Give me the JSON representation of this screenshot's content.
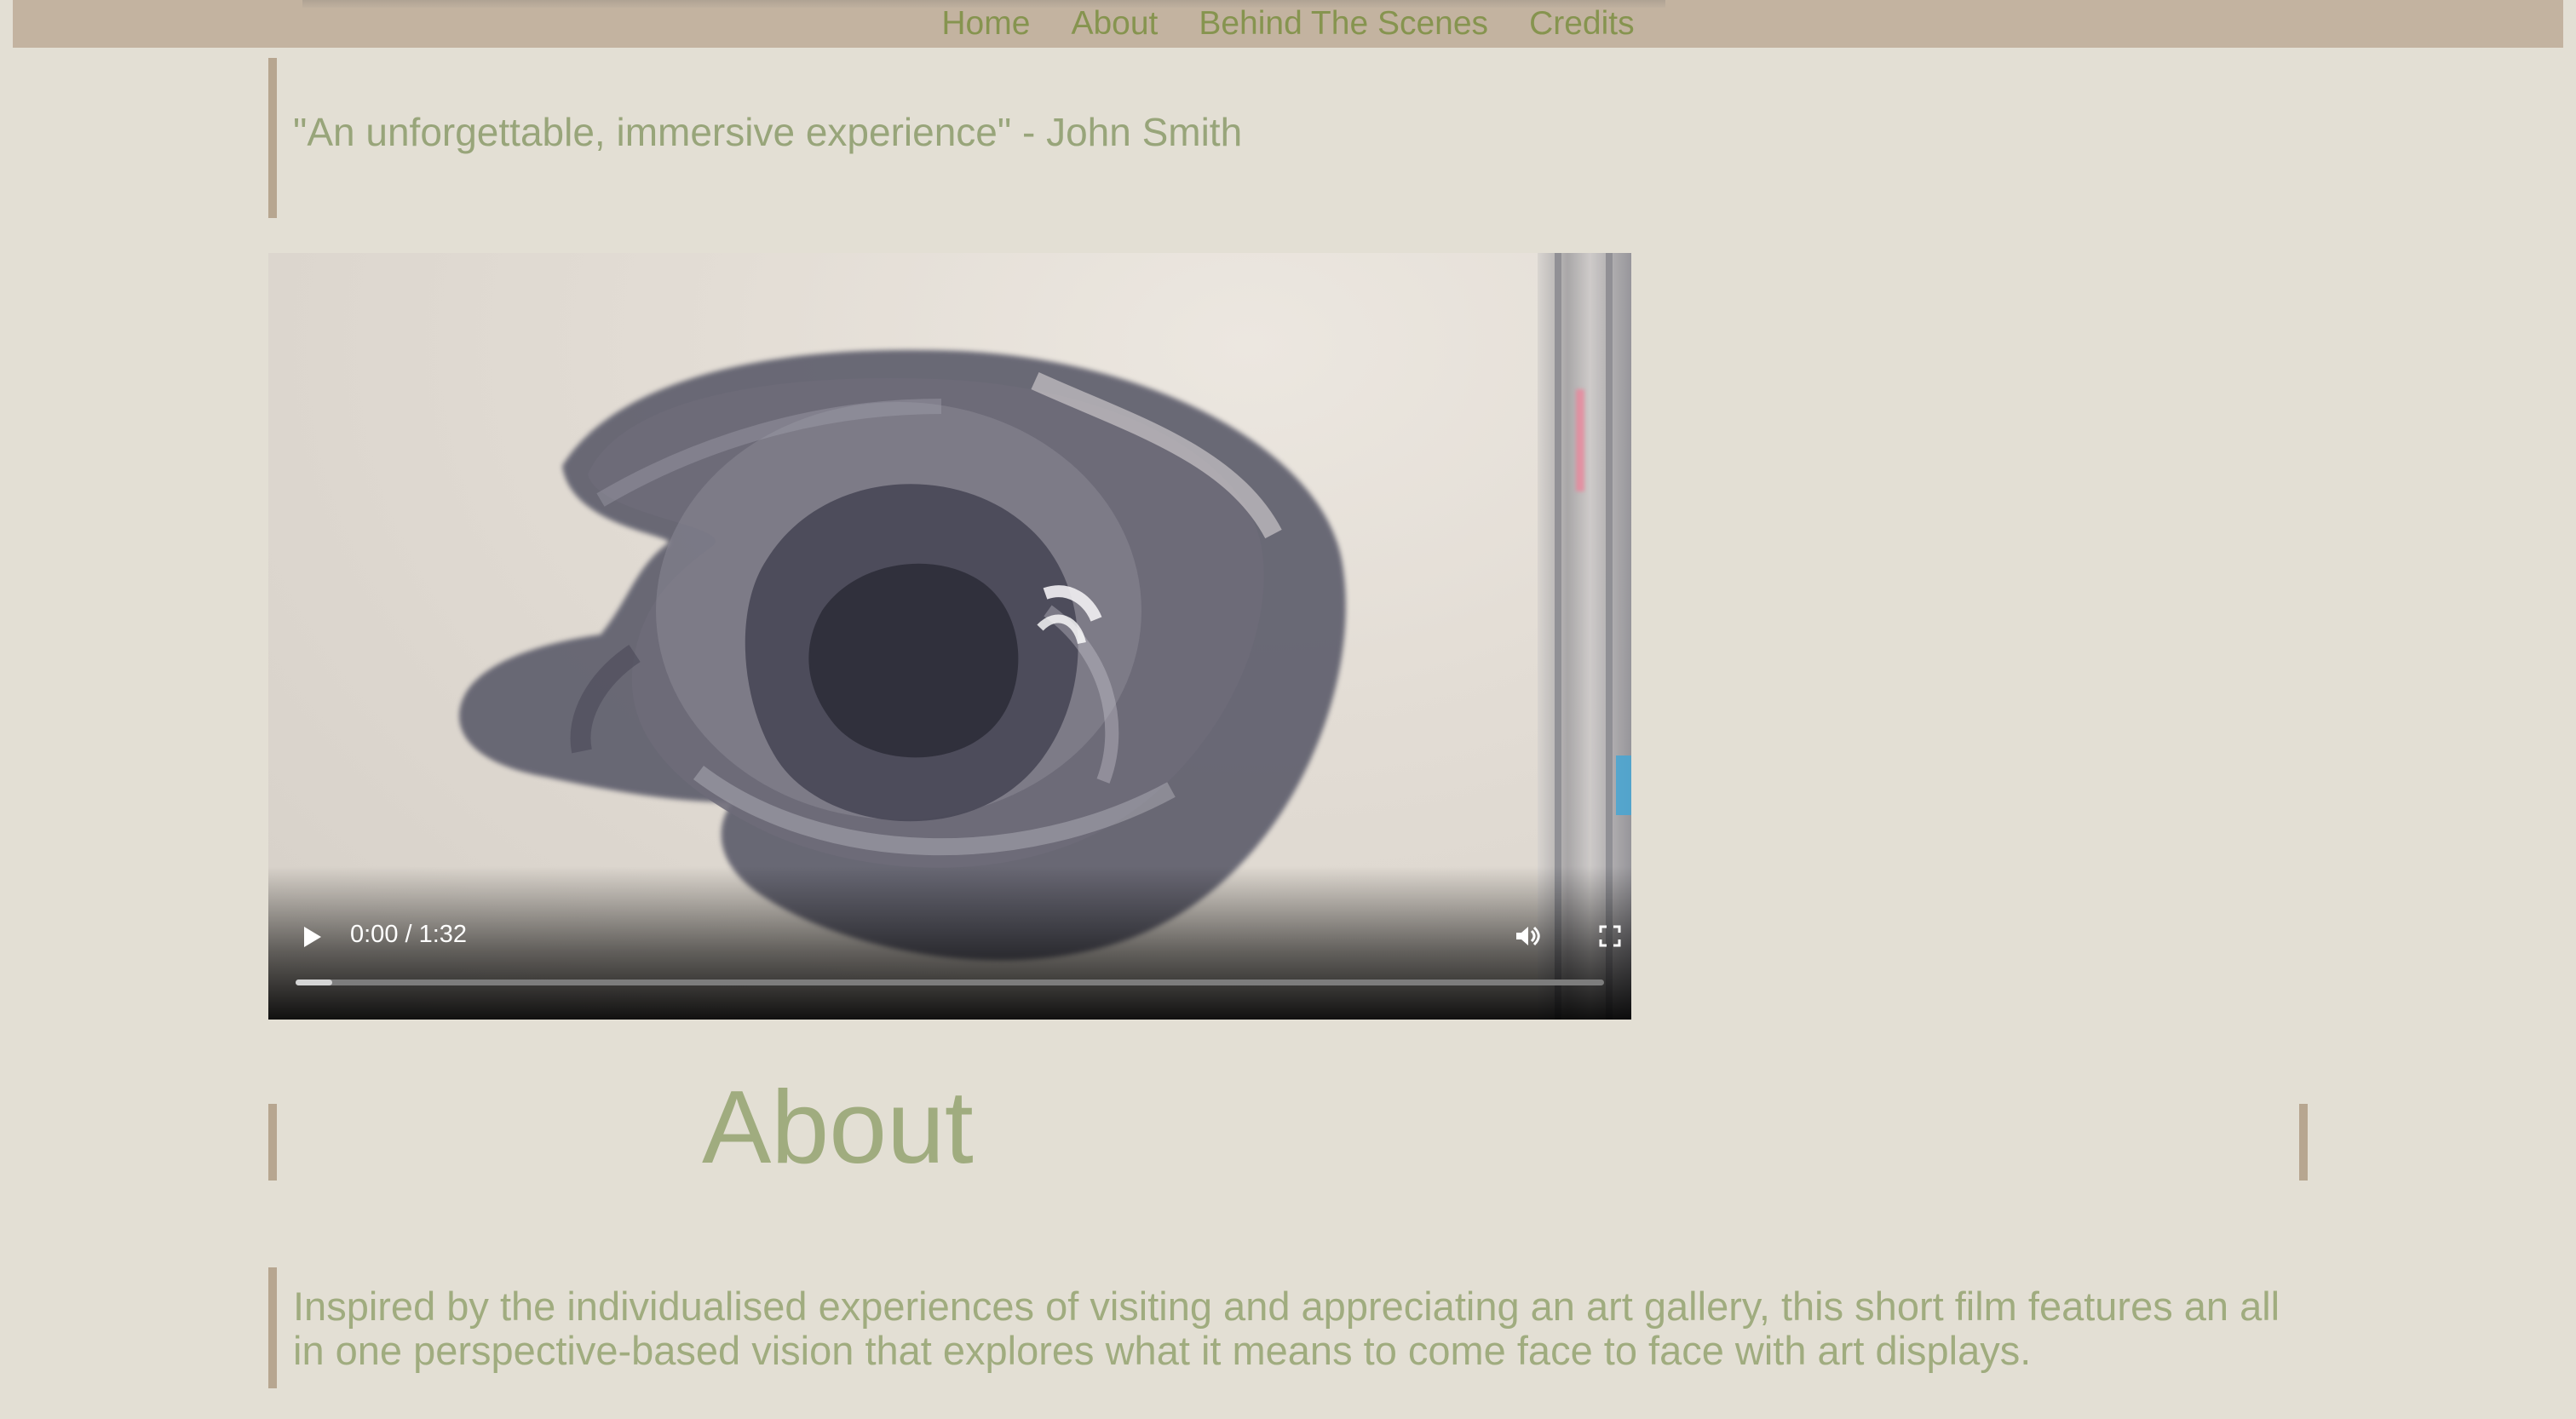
{
  "nav": {
    "items": [
      {
        "label": "Home"
      },
      {
        "label": "About"
      },
      {
        "label": "Behind The Scenes"
      },
      {
        "label": "Credits"
      }
    ]
  },
  "quote": {
    "text": "\"An unforgettable, immersive experience\" - John Smith"
  },
  "video": {
    "current_time": "0:00",
    "duration": "1:32",
    "time_display": "0:00 / 1:32",
    "progress_fraction": 0.0,
    "buffered_fraction": 0.028,
    "icons": {
      "play": "play-icon",
      "volume": "volume-icon",
      "fullscreen": "fullscreen-icon",
      "more": "more-options-icon"
    }
  },
  "about": {
    "heading": "About",
    "body": "Inspired by the individualised experiences of visiting and appreciating an art gallery, this short film features an all in one perspective-based vision that explores what it means to come face to face with art displays."
  },
  "colors": {
    "page_background": "#e3dfd4",
    "nav_background": "#c3b3a0",
    "nav_text": "#86944f",
    "accent_text": "#a0ac7f",
    "border_accent": "#b7a690"
  }
}
